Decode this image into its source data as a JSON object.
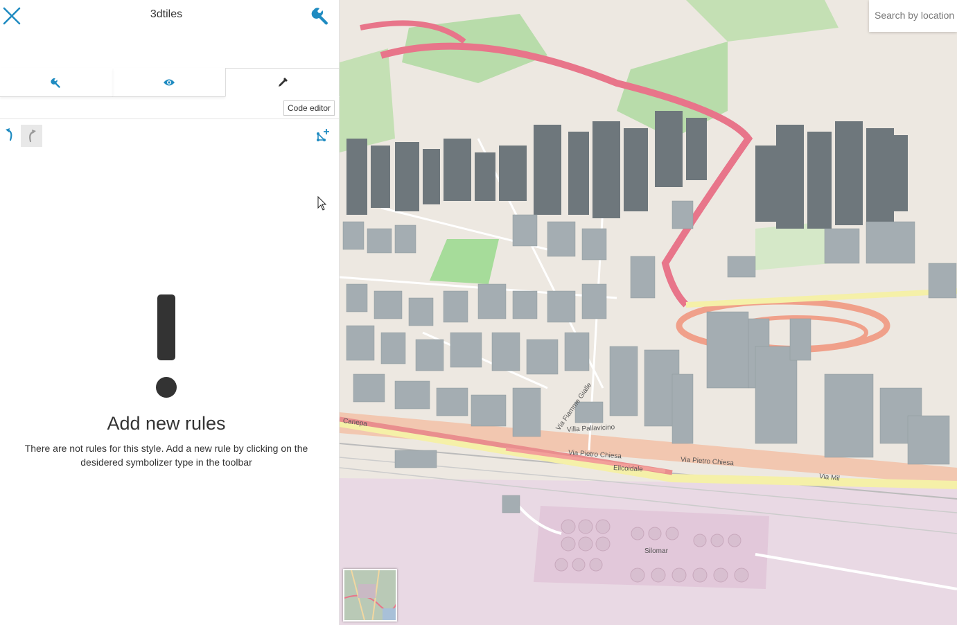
{
  "panel": {
    "title": "3dtiles",
    "tabs": [
      {
        "name": "settings",
        "icon": "wrench-icon"
      },
      {
        "name": "visibility",
        "icon": "eye-icon"
      },
      {
        "name": "style",
        "icon": "dropper-icon"
      }
    ],
    "active_tab": "style",
    "tooltip": "Code editor",
    "empty_state": {
      "title": "Add new rules",
      "description": "There are not rules for this style. Add a new rule by clicking on the desidered symbolizer type in the toolbar"
    }
  },
  "map": {
    "search_placeholder": "Search by location",
    "labels": {
      "via_pietro_chiesa_1": "Via Pietro Chiesa",
      "via_pietro_chiesa_2": "Via Pietro Chiesa",
      "elicoidale": "Elicoidale",
      "via_milano": "Via Mil",
      "canepa": "Canepa",
      "villa_pallavicino": "Villa Pallavicino",
      "via_fiamme_gialle": "Via Fiamme Gialle",
      "silomar": "Silomar"
    }
  },
  "colors": {
    "accent": "#1f8bc1",
    "text": "#333333",
    "building": "#9aa3a9",
    "road_pink": "#e8758a",
    "park": "#a9d6a0"
  }
}
